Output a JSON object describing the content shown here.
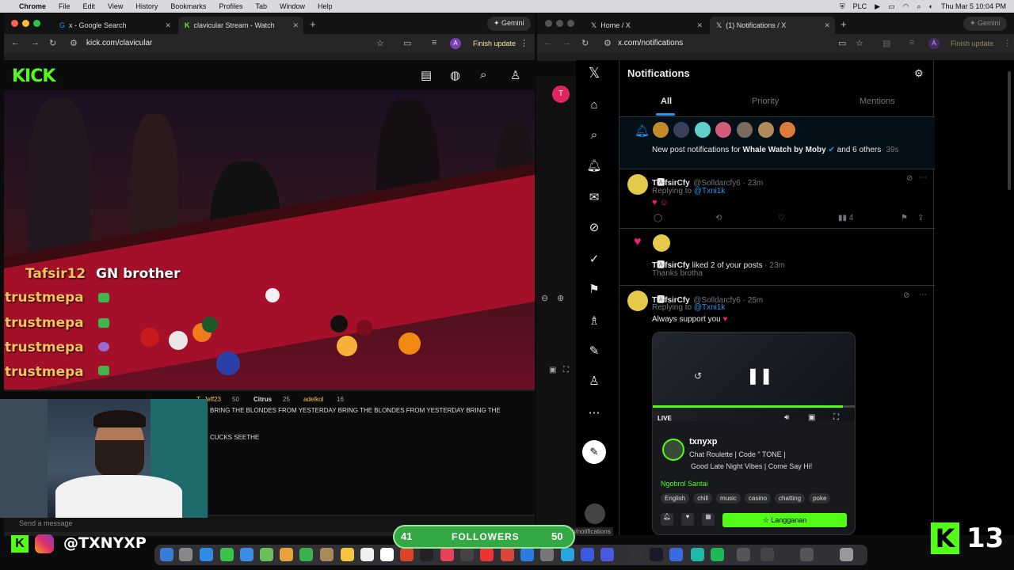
{
  "menubar": {
    "app": "Chrome",
    "items": [
      "File",
      "Edit",
      "View",
      "History",
      "Bookmarks",
      "Profiles",
      "Tab",
      "Window",
      "Help"
    ],
    "clock": "Thu Mar 5  10:04 PM",
    "plc": "PLC"
  },
  "left_window": {
    "tabs": [
      {
        "label": "x - Google Search"
      },
      {
        "label": "clavicular Stream - Watch"
      }
    ],
    "url": "kick.com/clavicular",
    "gemini": "Gemini",
    "finish": "Finish update",
    "profile": "A"
  },
  "right_window": {
    "tabs": [
      {
        "label": "Home / X"
      },
      {
        "label": "(1) Notifications / X"
      }
    ],
    "url": "x.com/notifications",
    "gemini": "Gemini",
    "finish": "Finish update",
    "profile": "A"
  },
  "kick": {
    "logo": "KICK",
    "overlay_chat": [
      {
        "user": "Tafsir12",
        "msg": "GN brother"
      },
      {
        "user": "trustmepa",
        "msg": ""
      },
      {
        "user": "trustmepa",
        "msg": ""
      },
      {
        "user": "trustmepa",
        "msg": ""
      },
      {
        "user": "trustmepa",
        "msg": ""
      }
    ],
    "gifters": [
      {
        "name": "T_Jeff23",
        "n": "50"
      },
      {
        "name": "Citrus",
        "n": "25"
      },
      {
        "name": "adelkol",
        "n": "16"
      }
    ],
    "chat_lines": [
      "BRING THE BLONDES FROM YESTERDAY BRING THE BLONDES FROM YESTERDAY BRING THE",
      "CUCKS SEETHE"
    ],
    "send_placeholder": "Send a message",
    "handle": "@TXNYXP"
  },
  "x": {
    "title": "Notifications",
    "tabs": [
      "All",
      "Priority",
      "Mentions"
    ],
    "n1": {
      "pre": "New post notifications for ",
      "bold": "Whale Watch by Moby",
      "post": " and 6 others",
      "time": "· 39s"
    },
    "n2": {
      "name": "T🅰fsirCfy",
      "handle": "@Solldarcfy6 · 23m",
      "reply_pre": "Replying to ",
      "reply_to": "@Txni1k",
      "stat": "4"
    },
    "n3": {
      "name": "T🅰fsirCfy",
      "text": " liked 2 of your posts",
      "time": " · 23m",
      "sub": "Thanks brotha"
    },
    "n4": {
      "name": "T🅰fsirCfy",
      "handle": "@Solldarcfy6 · 25m",
      "reply_pre": "Replying to ",
      "reply_to": "@Txni1k",
      "body": "Always support you",
      "card": {
        "streamer": "txnyxp",
        "line1": "Chat Roulette | Code \" TONE |",
        "line2": "Good Late Night Vibes | Come Say Hi!",
        "cat": "Ngobrol Santai",
        "tags": [
          "English",
          "chill",
          "music",
          "casino",
          "chatting",
          "poke"
        ],
        "sub": "Langganan",
        "live": "LIVE"
      }
    },
    "status_url": "https://x.com/notifications"
  },
  "followers": {
    "current": "41",
    "label": "FOLLOWERS",
    "goal": "50"
  },
  "corner_count": "13",
  "colors": {
    "kick_green": "#53fc18",
    "x_blue": "#1d9bf0",
    "table_red": "#a4102a"
  }
}
